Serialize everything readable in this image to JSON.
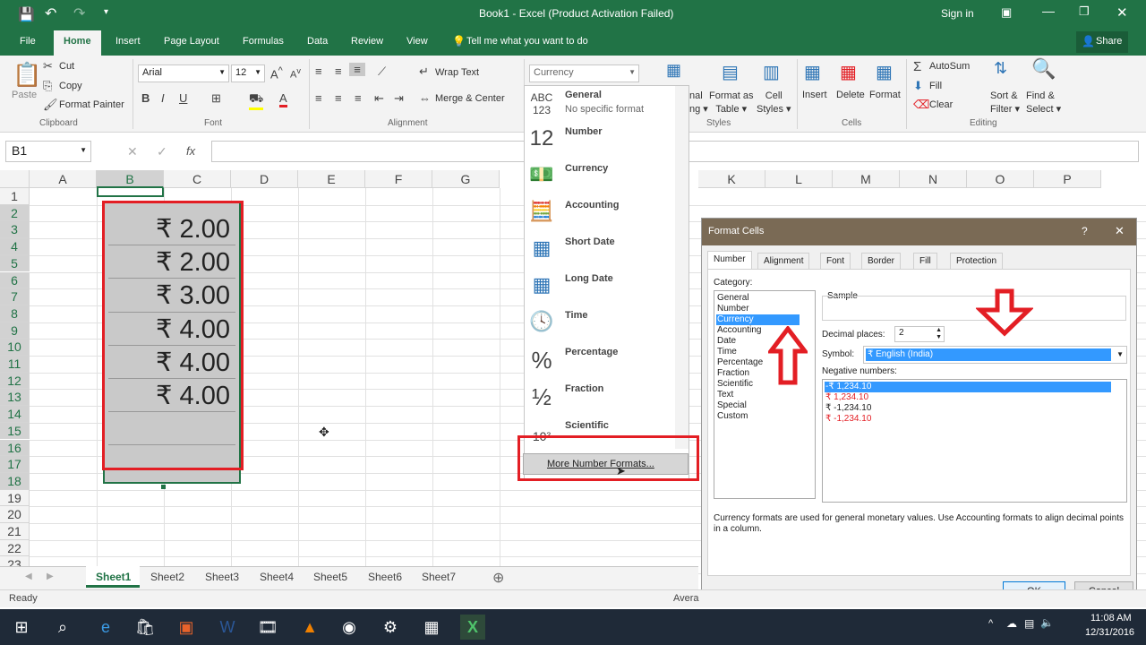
{
  "window": {
    "title": "Book1  -  Excel (Product Activation Failed)",
    "sign_in": "Sign in"
  },
  "tabs": [
    {
      "label": "File"
    },
    {
      "label": "Home"
    },
    {
      "label": "Insert"
    },
    {
      "label": "Page Layout"
    },
    {
      "label": "Formulas"
    },
    {
      "label": "Data"
    },
    {
      "label": "Review"
    },
    {
      "label": "View"
    }
  ],
  "tell_me": "Tell me what you want to do",
  "share": "Share",
  "ribbon": {
    "clipboard": {
      "paste": "Paste",
      "cut": "Cut",
      "copy": "Copy",
      "format_painter": "Format Painter",
      "group": "Clipboard"
    },
    "font": {
      "name": "Arial",
      "size": "12",
      "group": "Font"
    },
    "alignment": {
      "wrap": "Wrap Text",
      "merge": "Merge & Center",
      "group": "Alignment"
    },
    "number": {
      "format": "Currency"
    },
    "styles": {
      "conditional_partial": "nal\nng",
      "format_table": "Format as\nTable",
      "cell_styles": "Cell\nStyles",
      "group": "Styles"
    },
    "cells": {
      "insert": "Insert",
      "delete": "Delete",
      "format": "Format",
      "group": "Cells"
    },
    "editing": {
      "autosum": "AutoSum",
      "fill": "Fill",
      "clear": "Clear",
      "sort": "Sort &\nFilter",
      "find": "Find &\nSelect",
      "group": "Editing"
    }
  },
  "formula_bar": {
    "name_box": "B1",
    "fx": "fx",
    "content": ""
  },
  "columns": [
    "A",
    "B",
    "C",
    "D",
    "E",
    "F",
    "G",
    "K",
    "L",
    "M",
    "N",
    "O",
    "P"
  ],
  "rows": [
    "1",
    "2",
    "3",
    "4",
    "5",
    "6",
    "7",
    "8",
    "9",
    "10",
    "11",
    "12",
    "13",
    "14",
    "15",
    "16",
    "17",
    "18",
    "19",
    "20",
    "21",
    "22",
    "23"
  ],
  "cells": [
    "₹ 2.00",
    "₹ 2.00",
    "₹ 3.00",
    "₹ 4.00",
    "₹ 4.00",
    "₹ 4.00"
  ],
  "number_dropdown": {
    "items": [
      {
        "icon": "ABC 123",
        "label": "General",
        "sub": "No specific format"
      },
      {
        "icon": "12",
        "label": "Number",
        "sub": ""
      },
      {
        "icon": "currency-icon",
        "label": "Currency",
        "sub": ""
      },
      {
        "icon": "accounting-icon",
        "label": "Accounting",
        "sub": ""
      },
      {
        "icon": "calendar-icon",
        "label": "Short Date",
        "sub": ""
      },
      {
        "icon": "calendar-icon",
        "label": "Long Date",
        "sub": ""
      },
      {
        "icon": "clock-icon",
        "label": "Time",
        "sub": ""
      },
      {
        "icon": "%",
        "label": "Percentage",
        "sub": ""
      },
      {
        "icon": "½",
        "label": "Fraction",
        "sub": ""
      },
      {
        "icon": "10²",
        "label": "Scientific",
        "sub": ""
      }
    ],
    "more": "More Number Formats..."
  },
  "dialog": {
    "title": "Format Cells",
    "help": "?",
    "close": "✕",
    "tabs": [
      "Number",
      "Alignment",
      "Font",
      "Border",
      "Fill",
      "Protection"
    ],
    "category_label": "Category:",
    "categories": [
      "General",
      "Number",
      "Currency",
      "Accounting",
      "Date",
      "Time",
      "Percentage",
      "Fraction",
      "Scientific",
      "Text",
      "Special",
      "Custom"
    ],
    "selected_category": "Currency",
    "sample_label": "Sample",
    "decimal_label": "Decimal places:",
    "decimal_value": "2",
    "symbol_label": "Symbol:",
    "symbol_value": "₹ English (India)",
    "negative_label": "Negative numbers:",
    "negatives": [
      {
        "text": "-₹ 1,234.10",
        "color": "#ffffff",
        "selected": true
      },
      {
        "text": "₹ 1,234.10",
        "color": "#e31e24",
        "selected": false
      },
      {
        "text": "₹ -1,234.10",
        "color": "#222222",
        "selected": false
      },
      {
        "text": "₹ -1,234.10",
        "color": "#e31e24",
        "selected": false
      }
    ],
    "description": "Currency formats are used for general monetary values.  Use Accounting formats to align decimal points in a column.",
    "ok": "OK",
    "cancel": "Cancel"
  },
  "sheets": [
    "Sheet1",
    "Sheet2",
    "Sheet3",
    "Sheet4",
    "Sheet5",
    "Sheet6",
    "Sheet7"
  ],
  "status": {
    "ready": "Ready",
    "average_partial": "Avera"
  },
  "taskbar": {
    "time": "11:08 AM",
    "date": "12/31/2016"
  },
  "colors": {
    "excel_green": "#217346",
    "highlight_red": "#e31e24",
    "selection_blue": "#3399ff"
  }
}
